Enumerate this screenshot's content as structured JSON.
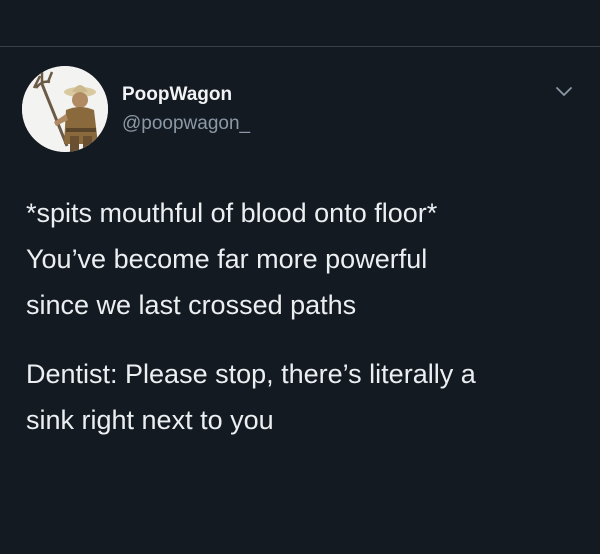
{
  "tweet": {
    "author": {
      "display_name": "PoopWagon",
      "handle": "@poopwagon_",
      "avatar_icon": "avatar-runescape-character-with-trident"
    },
    "menu_icon": "chevron-down-icon",
    "paragraphs": [
      {
        "lines": [
          "*spits mouthful of blood onto floor*",
          "You’ve become far more powerful",
          "since we last crossed paths"
        ]
      },
      {
        "lines": [
          "Dentist: Please stop, there’s literally a",
          "sink right next to you"
        ]
      }
    ]
  },
  "colors": {
    "background": "#141a22",
    "text": "#e7e9ea",
    "secondary_text": "#8b98a5",
    "divider": "#3a414a"
  }
}
